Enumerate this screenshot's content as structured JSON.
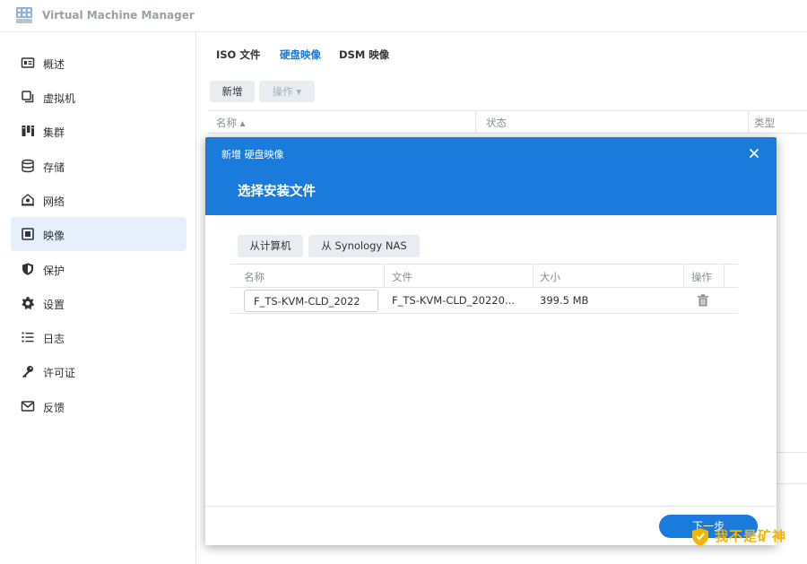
{
  "app": {
    "title": "Virtual Machine Manager",
    "icon": "vmm-app-icon"
  },
  "sidebar": {
    "items": [
      {
        "label": "概述",
        "icon": "overview-icon"
      },
      {
        "label": "虚拟机",
        "icon": "vm-icon"
      },
      {
        "label": "集群",
        "icon": "cluster-icon"
      },
      {
        "label": "存储",
        "icon": "storage-icon"
      },
      {
        "label": "网络",
        "icon": "network-icon"
      },
      {
        "label": "映像",
        "icon": "image-icon",
        "active": true
      },
      {
        "label": "保护",
        "icon": "shield-icon"
      },
      {
        "label": "设置",
        "icon": "gear-icon"
      },
      {
        "label": "日志",
        "icon": "log-icon"
      },
      {
        "label": "许可证",
        "icon": "key-icon"
      },
      {
        "label": "反馈",
        "icon": "mail-icon"
      }
    ]
  },
  "main": {
    "tabs": [
      {
        "label": "ISO 文件"
      },
      {
        "label": "硬盘映像",
        "active": true
      },
      {
        "label": "DSM 映像"
      }
    ],
    "toolbar": {
      "new_label": "新增",
      "op_label": "操作 ▾"
    },
    "list": {
      "columns": [
        "名称 ▴",
        "状态",
        "类型"
      ]
    }
  },
  "dialog": {
    "small_title": "新增 硬盘映像",
    "title": "选择安装文件",
    "source_buttons": {
      "computer": "从计算机",
      "nas": "从 Synology NAS"
    },
    "table": {
      "columns": [
        "名称",
        "文件",
        "大小",
        "操作"
      ],
      "rows": [
        {
          "name": "F_TS-KVM-CLD_2022",
          "file": "F_TS-KVM-CLD_20220...",
          "size": "399.5 MB"
        }
      ]
    },
    "next_label": "下一步"
  },
  "watermark": {
    "text": "我不是矿神"
  },
  "colors": {
    "accent": "#1a7bdc",
    "active_bg": "#e5f0fb",
    "watermark": "#f5b400"
  }
}
